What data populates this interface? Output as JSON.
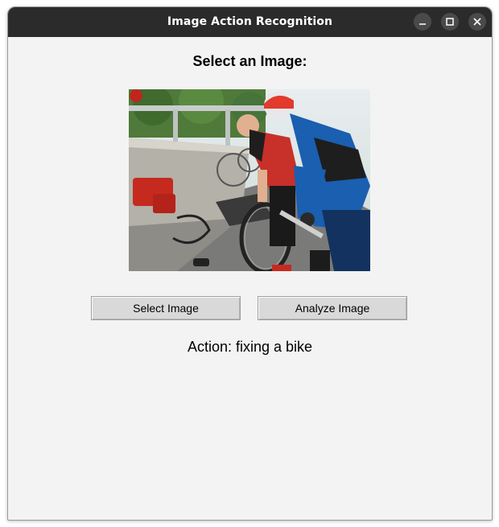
{
  "window": {
    "title": "Image Action Recognition",
    "controls": [
      "minimize-icon",
      "maximize-icon",
      "close-icon"
    ]
  },
  "main": {
    "heading": "Select an Image:",
    "image": {
      "subject": "two cyclists fixing a bike on a roadside bridge"
    },
    "buttons": {
      "select_label": "Select Image",
      "analyze_label": "Analyze Image"
    },
    "result_text": "Action: fixing a bike"
  },
  "colors": {
    "titlebar": "#2b2b2b",
    "background": "#f3f3f3",
    "button": "#d9d9d9"
  }
}
